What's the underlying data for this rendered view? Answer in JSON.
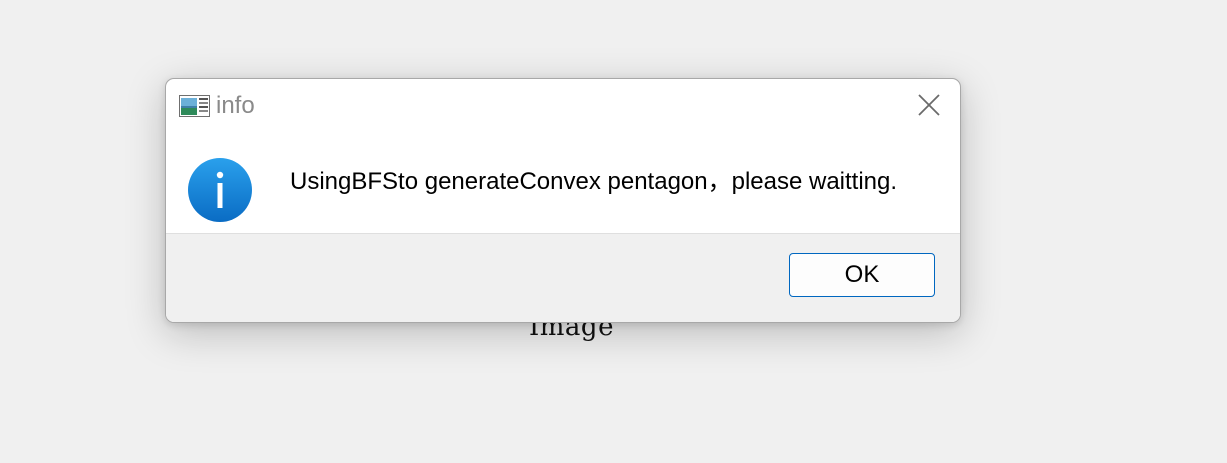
{
  "background": {
    "label": "Image"
  },
  "dialog": {
    "title": "info",
    "app_icon": "application-window-icon",
    "close_icon": "close-icon",
    "info_icon": "information-icon",
    "message": "UsingBFSto generateConvex pentagon，please waitting.",
    "ok_label": "OK"
  },
  "colors": {
    "accent": "#0067c0",
    "info_icon": "#1a87d8",
    "footer_bg": "#f0f0f0",
    "page_bg": "#f0f0f0"
  }
}
